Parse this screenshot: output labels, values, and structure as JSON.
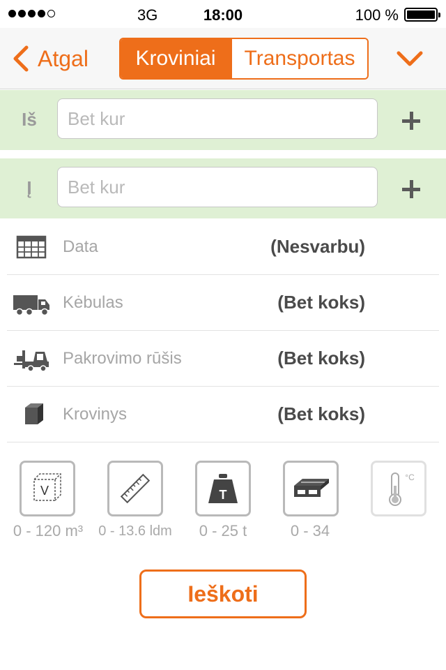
{
  "status_bar": {
    "network": "3G",
    "time": "18:00",
    "battery": "100 %"
  },
  "nav": {
    "back_label": "Atgal",
    "tabs": [
      {
        "label": "Kroviniai",
        "active": true
      },
      {
        "label": "Transportas",
        "active": false
      }
    ]
  },
  "route": {
    "from": {
      "label": "Iš",
      "placeholder": "Bet kur",
      "value": ""
    },
    "to": {
      "label": "Į",
      "placeholder": "Bet kur",
      "value": ""
    }
  },
  "options": [
    {
      "icon": "calendar-icon",
      "label": "Data",
      "value": "(Nesvarbu)"
    },
    {
      "icon": "truck-icon",
      "label": "Kėbulas",
      "value": "(Bet koks)"
    },
    {
      "icon": "forklift-icon",
      "label": "Pakrovimo rūšis",
      "value": "(Bet koks)"
    },
    {
      "icon": "box-icon",
      "label": "Krovinys",
      "value": "(Bet koks)"
    }
  ],
  "filters": [
    {
      "icon": "volume-icon",
      "glyph": "V",
      "caption": "0 - 120 m³"
    },
    {
      "icon": "ruler-icon",
      "caption": "0 - 13.6 ldm"
    },
    {
      "icon": "weight-icon",
      "glyph": "T",
      "caption": "0 - 25 t"
    },
    {
      "icon": "pallet-icon",
      "caption": "0 - 34"
    },
    {
      "icon": "thermometer-icon",
      "glyph": "°C",
      "caption": ""
    }
  ],
  "search_label": "Ieškoti",
  "colors": {
    "accent": "#ee6e1a",
    "route_bg": "#dff0d4",
    "muted_text": "#a6a6a6"
  }
}
